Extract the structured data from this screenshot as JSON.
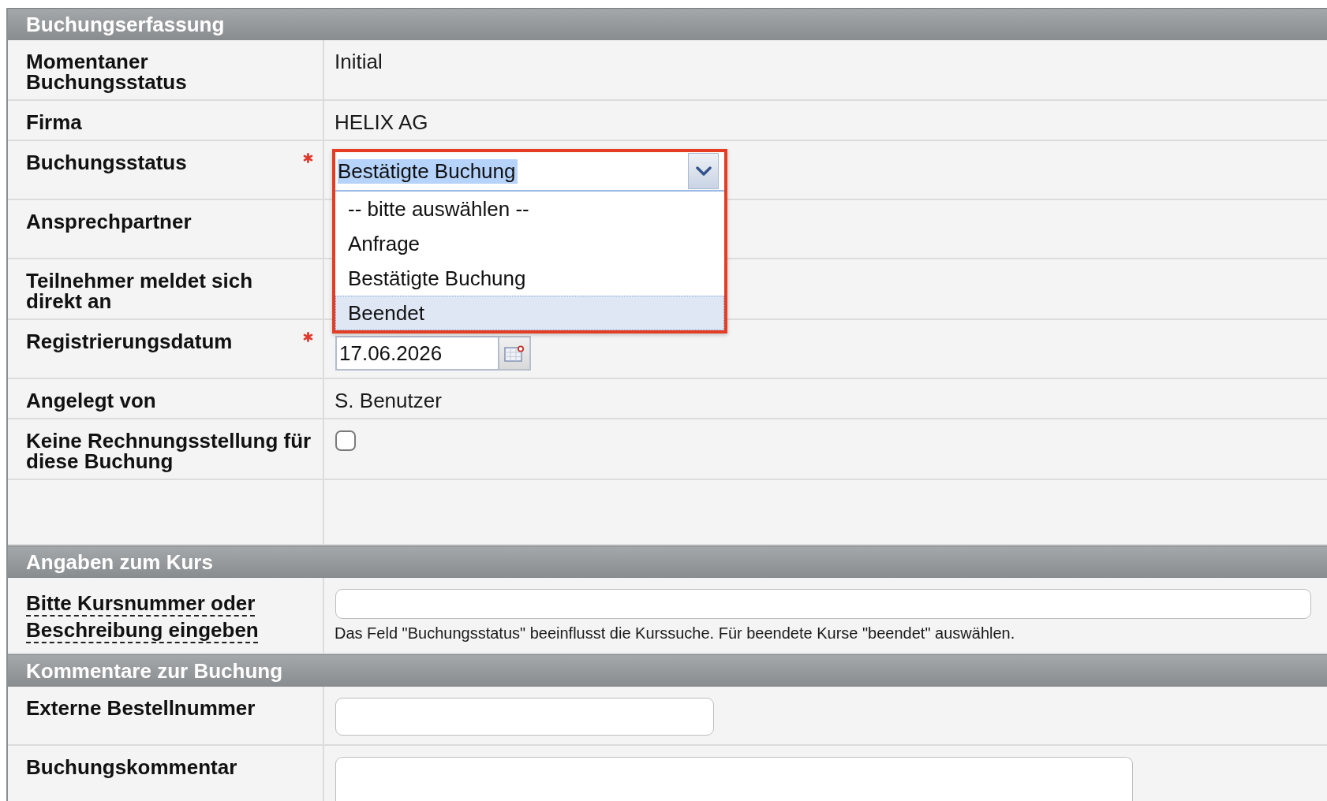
{
  "sections": [
    {
      "title": "Buchungserfassung",
      "rows": [
        {
          "kind": "text",
          "label": "Momentaner\nBuchungsstatus",
          "required": false,
          "has_tooltip": false,
          "value": "Initial"
        },
        {
          "kind": "text",
          "label": "Firma",
          "required": false,
          "has_tooltip": false,
          "value": "HELIX AG"
        },
        {
          "kind": "select",
          "label": "Buchungsstatus",
          "required": true,
          "has_tooltip": false,
          "value": "Bestätigte Buchung",
          "value_highlighted": true,
          "expanded": true,
          "annotated": true,
          "options": [
            {
              "label": "-- bitte auswählen --",
              "highlighted": false
            },
            {
              "label": "Anfrage",
              "highlighted": false
            },
            {
              "label": "Bestätigte Buchung",
              "highlighted": false
            },
            {
              "label": "Beendet",
              "highlighted": true
            }
          ]
        },
        {
          "kind": "covered",
          "label": "Ansprechpartner",
          "required": false,
          "has_tooltip": false
        },
        {
          "kind": "covered",
          "label": "Teilnehmer meldet sich\ndirekt an",
          "required": false,
          "has_tooltip": false
        },
        {
          "kind": "date",
          "label": "Registrierungsdatum",
          "required": true,
          "has_tooltip": false,
          "value": "17.06.2026"
        },
        {
          "kind": "text",
          "label": "Angelegt von",
          "required": false,
          "has_tooltip": false,
          "value": "S. Benutzer"
        },
        {
          "kind": "checkbox",
          "label": "Keine Rechnungsstellung für\ndiese Buchung",
          "required": false,
          "has_tooltip": false,
          "checked": false
        },
        {
          "kind": "blank"
        }
      ]
    },
    {
      "title": "Angaben zum Kurs",
      "rows": [
        {
          "kind": "search",
          "label": "Bitte Kursnummer oder\nBeschreibung eingeben",
          "required": false,
          "has_tooltip": true,
          "help": "Das Feld \"Buchungsstatus\" beeinflusst die Kurssuche. Für beendete Kurse \"beendet\" auswählen."
        }
      ]
    },
    {
      "title": "Kommentare zur Buchung",
      "rows": [
        {
          "kind": "input",
          "label": "Externe Bestellnummer",
          "required": false,
          "has_tooltip": false
        },
        {
          "kind": "textarea",
          "label": "Buchungskommentar",
          "required": false,
          "has_tooltip": false
        }
      ]
    }
  ]
}
